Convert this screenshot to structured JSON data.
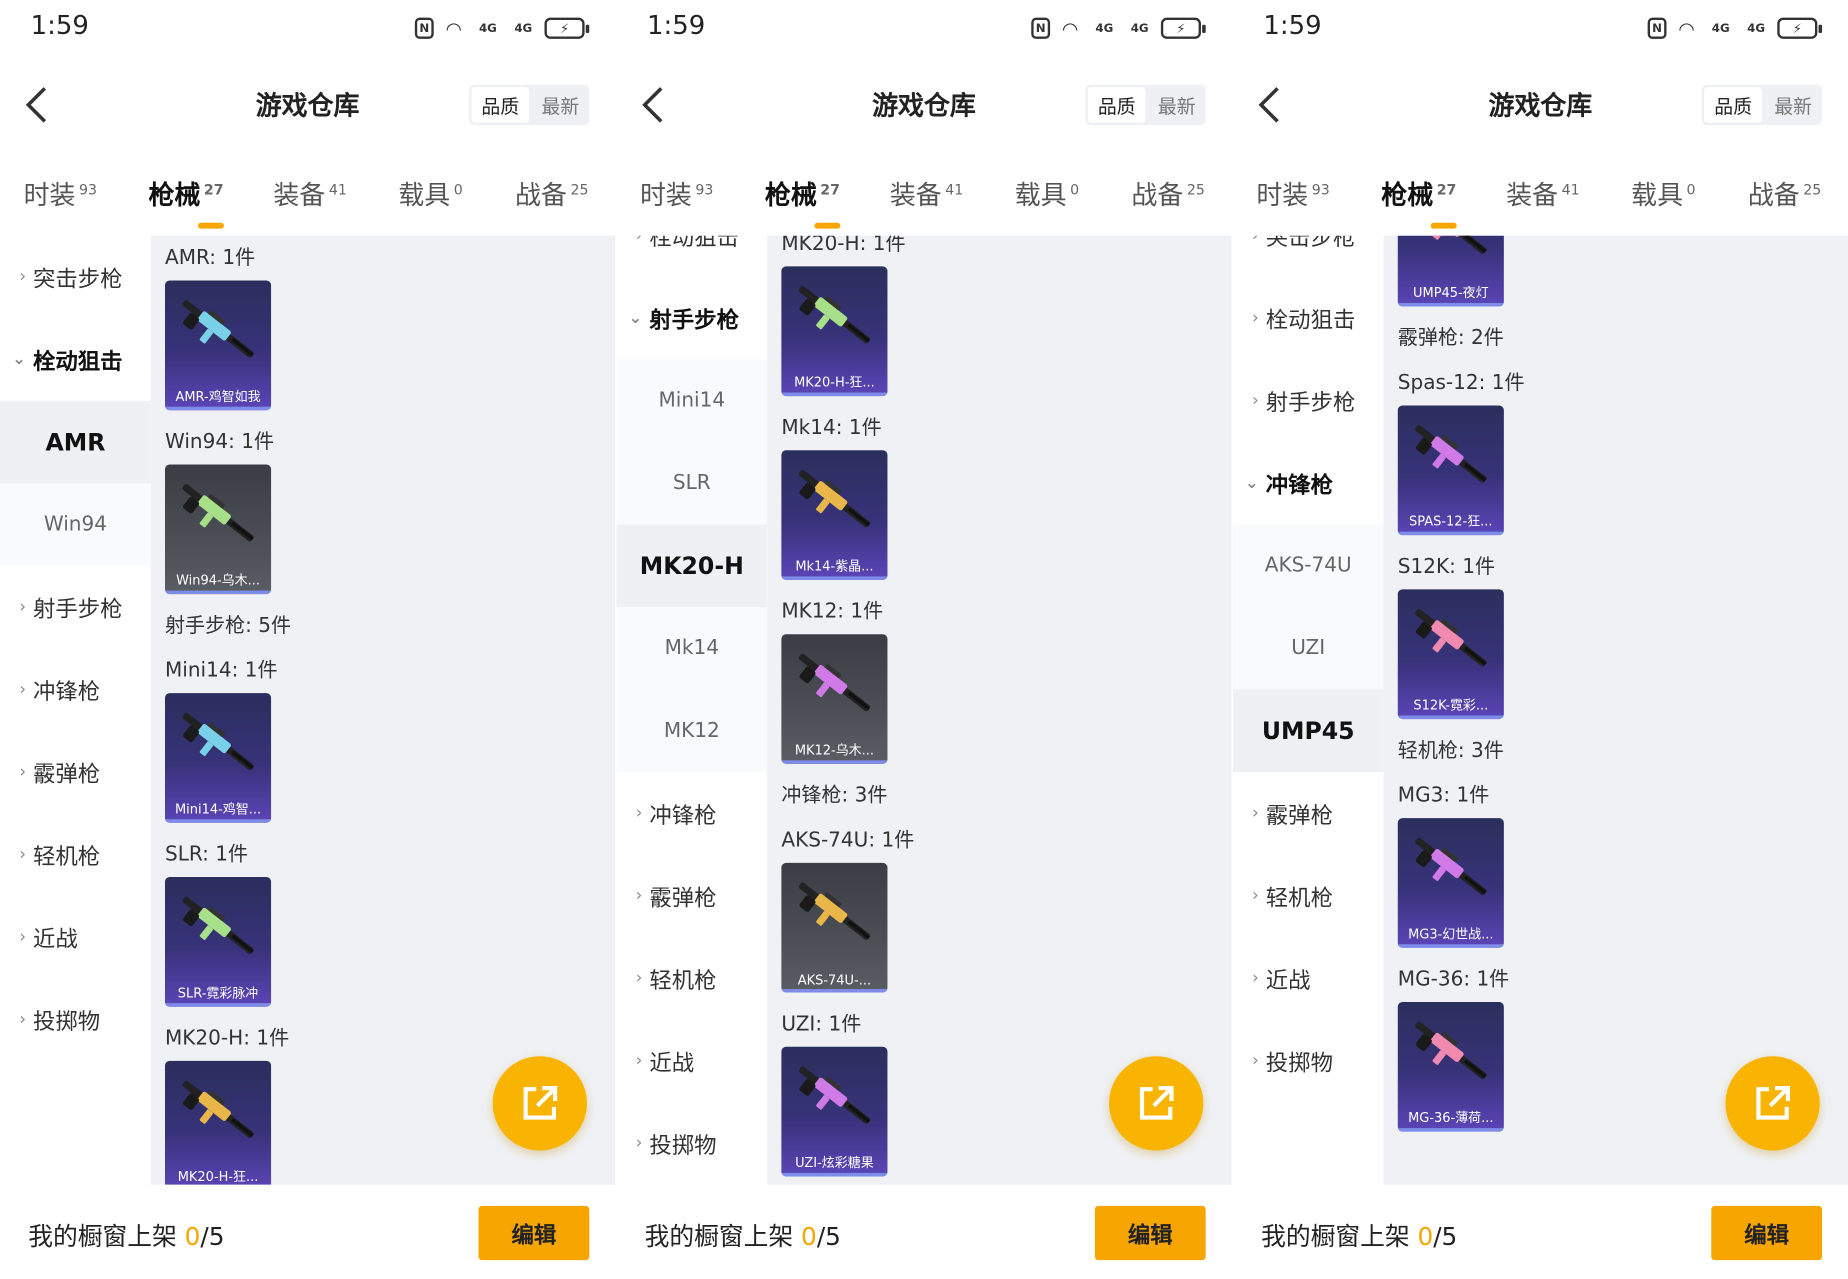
{
  "accent": "#f7a500",
  "card_purple": "#38327a",
  "card_gray": "#4c4f56",
  "status": {
    "time": "1:59",
    "signal_1": "4G",
    "signal_2": "4G"
  },
  "header": {
    "title": "游戏仓库",
    "sort_quality": "品质",
    "sort_latest": "最新"
  },
  "tabs": [
    {
      "label": "时装",
      "count": "93"
    },
    {
      "label": "枪械",
      "count": "27"
    },
    {
      "label": "装备",
      "count": "41"
    },
    {
      "label": "载具",
      "count": "0"
    },
    {
      "label": "战备",
      "count": "25"
    }
  ],
  "active_tab": "枪械",
  "bottom": {
    "prefix": "我的橱窗上架 ",
    "count": "0",
    "suffix": "/5",
    "edit_label": "编辑"
  },
  "panels": [
    {
      "sidebar": [
        {
          "label": "突击步枪",
          "kind": "cat"
        },
        {
          "label": "栓动狙击",
          "kind": "open"
        },
        {
          "label": "AMR",
          "kind": "sub",
          "active": true
        },
        {
          "label": "Win94",
          "kind": "sub"
        },
        {
          "label": "射手步枪",
          "kind": "cat"
        },
        {
          "label": "冲锋枪",
          "kind": "cat"
        },
        {
          "label": "霰弹枪",
          "kind": "cat"
        },
        {
          "label": "轻机枪",
          "kind": "cat"
        },
        {
          "label": "近战",
          "kind": "cat"
        },
        {
          "label": "投掷物",
          "kind": "cat"
        }
      ],
      "content": [
        {
          "t": "label",
          "text": "AMR: 1件"
        },
        {
          "t": "card",
          "caption": "AMR-鸡智如我",
          "style": "purple"
        },
        {
          "t": "label",
          "text": "Win94: 1件"
        },
        {
          "t": "card",
          "caption": "Win94-乌木...",
          "style": "gray"
        },
        {
          "t": "label",
          "text": "射手步枪: 5件"
        },
        {
          "t": "label",
          "text": "Mini14: 1件"
        },
        {
          "t": "card",
          "caption": "Mini14-鸡智...",
          "style": "purple"
        },
        {
          "t": "label",
          "text": "SLR: 1件"
        },
        {
          "t": "card",
          "caption": "SLR-霓彩脉冲",
          "style": "purple"
        },
        {
          "t": "label",
          "text": "MK20-H: 1件"
        },
        {
          "t": "card",
          "caption": "MK20-H-狂...",
          "style": "purple"
        }
      ]
    },
    {
      "sidebar": [
        {
          "label": "栓动狙击",
          "kind": "cat"
        },
        {
          "label": "射手步枪",
          "kind": "open"
        },
        {
          "label": "Mini14",
          "kind": "sub"
        },
        {
          "label": "SLR",
          "kind": "sub"
        },
        {
          "label": "MK20-H",
          "kind": "sub",
          "active": true
        },
        {
          "label": "Mk14",
          "kind": "sub"
        },
        {
          "label": "MK12",
          "kind": "sub"
        },
        {
          "label": "冲锋枪",
          "kind": "cat"
        },
        {
          "label": "霰弹枪",
          "kind": "cat"
        },
        {
          "label": "轻机枪",
          "kind": "cat"
        },
        {
          "label": "近战",
          "kind": "cat"
        },
        {
          "label": "投掷物",
          "kind": "cat"
        }
      ],
      "content": [
        {
          "t": "label",
          "text": "MK20-H: 1件"
        },
        {
          "t": "card",
          "caption": "MK20-H-狂...",
          "style": "purple"
        },
        {
          "t": "label",
          "text": "Mk14: 1件"
        },
        {
          "t": "card",
          "caption": "Mk14-紫晶...",
          "style": "purple"
        },
        {
          "t": "label",
          "text": "MK12: 1件"
        },
        {
          "t": "card",
          "caption": "MK12-乌木...",
          "style": "gray"
        },
        {
          "t": "label",
          "text": "冲锋枪: 3件"
        },
        {
          "t": "label",
          "text": "AKS-74U: 1件"
        },
        {
          "t": "card",
          "caption": "AKS-74U-...",
          "style": "gray"
        },
        {
          "t": "label",
          "text": "UZI: 1件"
        },
        {
          "t": "card",
          "caption": "UZI-炫彩糖果",
          "style": "purple"
        }
      ]
    },
    {
      "sidebar": [
        {
          "label": "突击步枪",
          "kind": "cat"
        },
        {
          "label": "栓动狙击",
          "kind": "cat"
        },
        {
          "label": "射手步枪",
          "kind": "cat"
        },
        {
          "label": "冲锋枪",
          "kind": "open"
        },
        {
          "label": "AKS-74U",
          "kind": "sub"
        },
        {
          "label": "UZI",
          "kind": "sub"
        },
        {
          "label": "UMP45",
          "kind": "sub",
          "active": true
        },
        {
          "label": "霰弹枪",
          "kind": "cat"
        },
        {
          "label": "轻机枪",
          "kind": "cat"
        },
        {
          "label": "近战",
          "kind": "cat"
        },
        {
          "label": "投掷物",
          "kind": "cat"
        }
      ],
      "content": [
        {
          "t": "card",
          "caption": "UMP45-夜灯",
          "style": "purple"
        },
        {
          "t": "label",
          "text": "霰弹枪: 2件"
        },
        {
          "t": "label",
          "text": "Spas-12: 1件"
        },
        {
          "t": "card",
          "caption": "SPAS-12-狂...",
          "style": "purple"
        },
        {
          "t": "label",
          "text": "S12K: 1件"
        },
        {
          "t": "card",
          "caption": "S12K-霓彩...",
          "style": "purple"
        },
        {
          "t": "label",
          "text": "轻机枪: 3件"
        },
        {
          "t": "label",
          "text": "MG3: 1件"
        },
        {
          "t": "card",
          "caption": "MG3-幻世战...",
          "style": "purple"
        },
        {
          "t": "label",
          "text": "MG-36: 1件"
        },
        {
          "t": "card",
          "caption": "MG-36-薄荷...",
          "style": "purple"
        }
      ]
    }
  ]
}
